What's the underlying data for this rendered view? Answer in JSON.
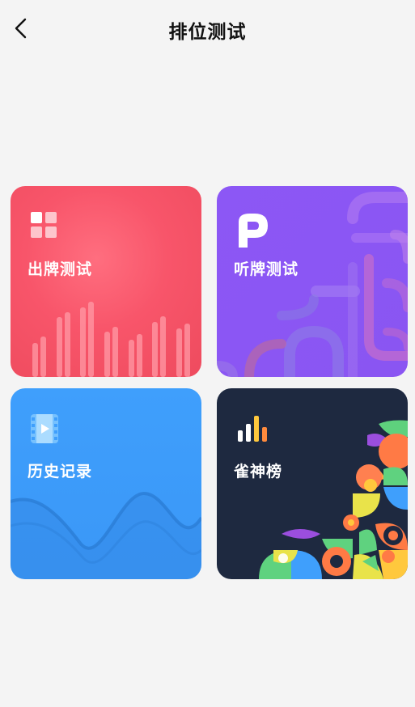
{
  "header": {
    "title": "排位测试",
    "back_icon": "chevron-left-icon"
  },
  "cards": [
    {
      "id": "play-test",
      "label": "出牌测试",
      "icon": "grid-icon",
      "color": "#f8556a"
    },
    {
      "id": "listen-test",
      "label": "听牌测试",
      "icon": "p-logo-icon",
      "color": "#8c57f5"
    },
    {
      "id": "history",
      "label": "历史记录",
      "icon": "video-film-icon",
      "color": "#3f9ffc"
    },
    {
      "id": "leaderboard",
      "label": "雀神榜",
      "icon": "bar-chart-icon",
      "color": "#1e2940"
    }
  ]
}
